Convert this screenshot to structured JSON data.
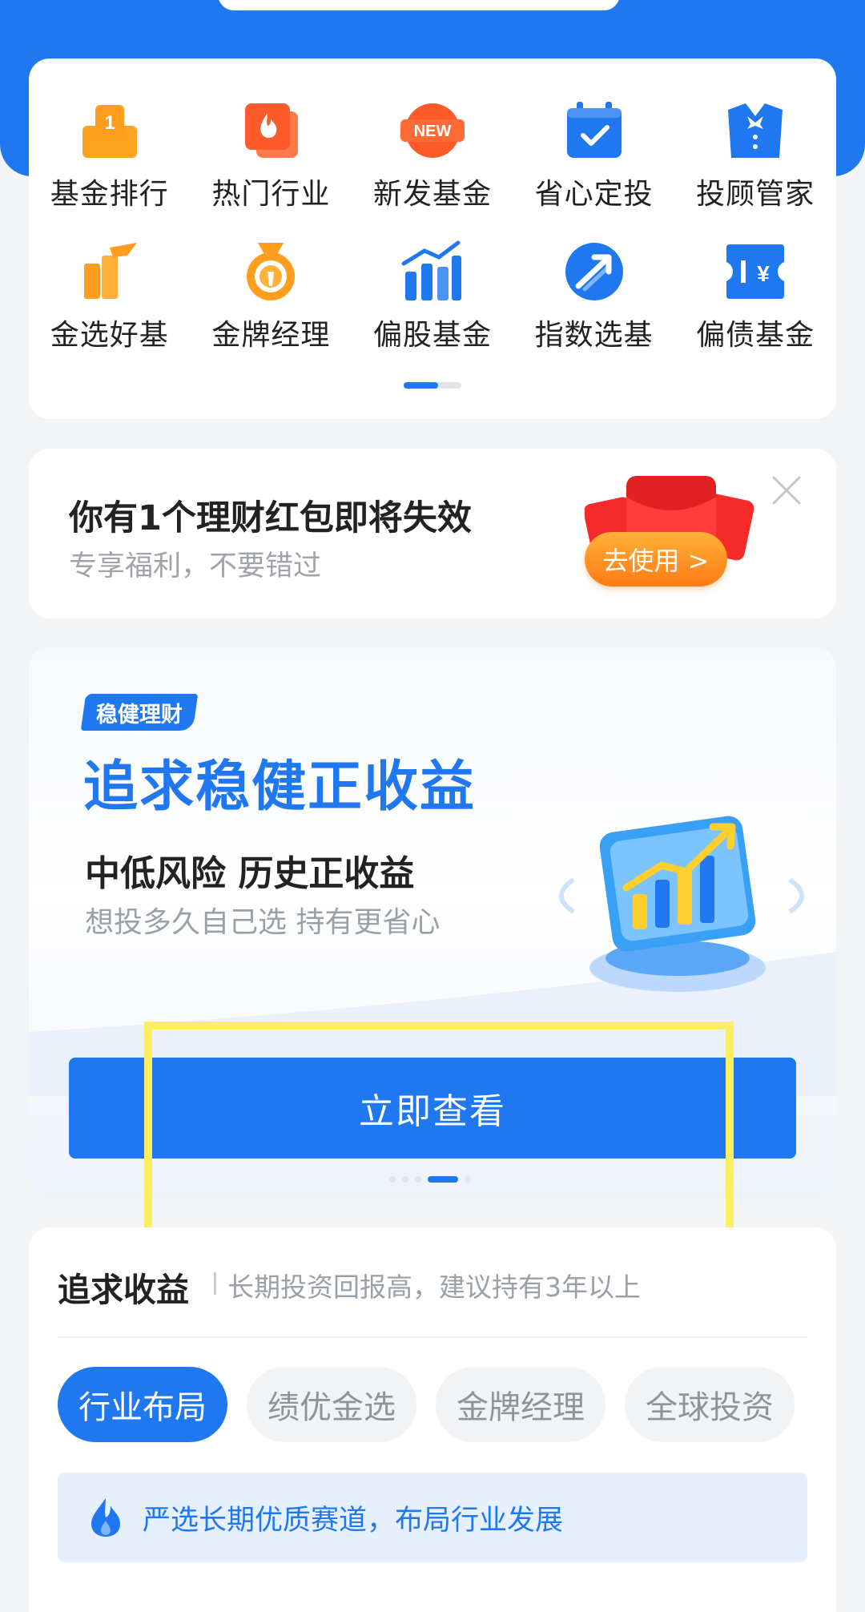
{
  "menu": {
    "items": [
      {
        "label": "基金排行",
        "icon": "ranking-trophy-icon"
      },
      {
        "label": "热门行业",
        "icon": "flame-card-icon"
      },
      {
        "label": "新发基金",
        "icon": "new-badge-icon"
      },
      {
        "label": "省心定投",
        "icon": "calendar-check-icon"
      },
      {
        "label": "投顾管家",
        "icon": "butler-suit-icon"
      },
      {
        "label": "金选好基",
        "icon": "golden-pick-icon"
      },
      {
        "label": "金牌经理",
        "icon": "medal-icon"
      },
      {
        "label": "偏股基金",
        "icon": "bar-chart-icon"
      },
      {
        "label": "指数选基",
        "icon": "index-arrow-icon"
      },
      {
        "label": "偏债基金",
        "icon": "bond-yen-icon"
      }
    ],
    "pager_active_fraction": 0.6
  },
  "red_packet": {
    "title": "你有1个理财红包即将失效",
    "subtitle": "专享福利，不要错过",
    "button": "去使用 >"
  },
  "promo": {
    "tag": "稳健理财",
    "title": "追求稳健正收益",
    "subtitle1": "中低风险 历史正收益",
    "subtitle2": "想投多久自己选 持有更省心",
    "button": "立即查看",
    "carousel_active_index": 3,
    "carousel_count": 5
  },
  "section": {
    "title": "追求收益",
    "desc": "长期投资回报高，建议持有3年以上",
    "tabs": [
      "行业布局",
      "绩优金选",
      "金牌经理",
      "全球投资"
    ],
    "active_tab": 0,
    "info": "严选长期优质赛道，布局行业发展"
  },
  "colors": {
    "brand_blue": "#1f78f0",
    "orange": "#ff9d1f",
    "highlight_yellow": "#fcee5e"
  }
}
